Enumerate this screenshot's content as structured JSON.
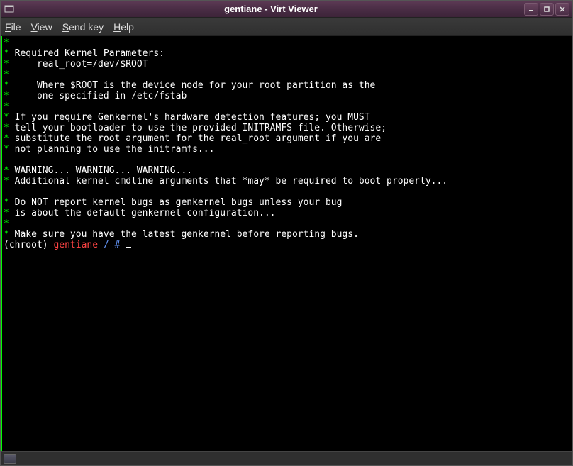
{
  "window": {
    "title": "gentiane - Virt Viewer"
  },
  "menu": {
    "file": "File",
    "view": "View",
    "sendkey": "Send key",
    "help": "Help"
  },
  "terminal": {
    "lines": [
      [
        {
          "c": "g",
          "t": "*"
        }
      ],
      [
        {
          "c": "g",
          "t": "*"
        },
        {
          "c": "w",
          "t": " Required Kernel Parameters:"
        }
      ],
      [
        {
          "c": "g",
          "t": "*"
        },
        {
          "c": "w",
          "t": "     real_root=/dev/$ROOT"
        }
      ],
      [
        {
          "c": "g",
          "t": "*"
        }
      ],
      [
        {
          "c": "g",
          "t": "*"
        },
        {
          "c": "w",
          "t": "     Where $ROOT is the device node for your root partition as the"
        }
      ],
      [
        {
          "c": "g",
          "t": "*"
        },
        {
          "c": "w",
          "t": "     one specified in /etc/fstab"
        }
      ],
      [
        {
          "c": "g",
          "t": "*"
        }
      ],
      [
        {
          "c": "g",
          "t": "*"
        },
        {
          "c": "w",
          "t": " If you require Genkernel's hardware detection features; you MUST"
        }
      ],
      [
        {
          "c": "g",
          "t": "*"
        },
        {
          "c": "w",
          "t": " tell your bootloader to use the provided INITRAMFS file. Otherwise;"
        }
      ],
      [
        {
          "c": "g",
          "t": "*"
        },
        {
          "c": "w",
          "t": " substitute the root argument for the real_root argument if you are"
        }
      ],
      [
        {
          "c": "g",
          "t": "*"
        },
        {
          "c": "w",
          "t": " not planning to use the initramfs..."
        }
      ],
      [],
      [
        {
          "c": "g",
          "t": "*"
        },
        {
          "c": "w",
          "t": " WARNING... WARNING... WARNING..."
        }
      ],
      [
        {
          "c": "g",
          "t": "*"
        },
        {
          "c": "w",
          "t": " Additional kernel cmdline arguments that *may* be required to boot properly..."
        }
      ],
      [],
      [
        {
          "c": "g",
          "t": "*"
        },
        {
          "c": "w",
          "t": " Do NOT report kernel bugs as genkernel bugs unless your bug"
        }
      ],
      [
        {
          "c": "g",
          "t": "*"
        },
        {
          "c": "w",
          "t": " is about the default genkernel configuration..."
        }
      ],
      [
        {
          "c": "g",
          "t": "*"
        }
      ],
      [
        {
          "c": "g",
          "t": "*"
        },
        {
          "c": "w",
          "t": " Make sure you have the latest genkernel before reporting bugs."
        }
      ]
    ],
    "prompt": {
      "prefix": "(chroot) ",
      "host": "gentiane",
      "path": " / # "
    }
  }
}
